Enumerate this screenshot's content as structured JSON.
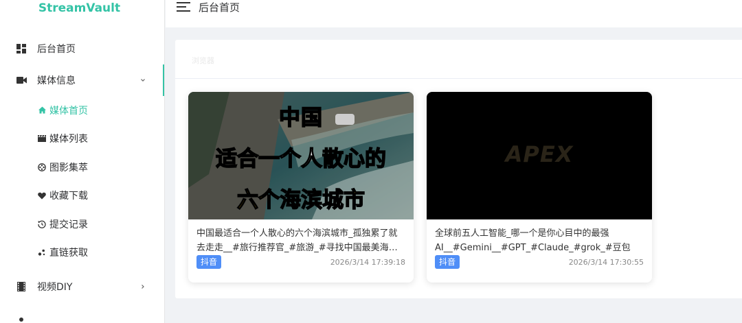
{
  "app": {
    "logo": "StreamVault"
  },
  "header": {
    "title": "后台首页"
  },
  "sidebar": {
    "items": [
      {
        "label": "后台首页",
        "icon": "dashboard-icon"
      },
      {
        "label": "媒体信息",
        "icon": "video-camera-icon",
        "expanded": true,
        "children": [
          {
            "label": "媒体首页",
            "icon": "home-icon",
            "active": true
          },
          {
            "label": "媒体列表",
            "icon": "clapperboard-icon"
          },
          {
            "label": "图影集萃",
            "icon": "film-reel-icon"
          },
          {
            "label": "收藏下载",
            "icon": "heart-icon"
          },
          {
            "label": "提交记录",
            "icon": "history-icon"
          },
          {
            "label": "直链获取",
            "icon": "link-icon"
          }
        ]
      },
      {
        "label": "视频DIY",
        "icon": "film-icon",
        "expanded": false
      }
    ]
  },
  "panel": {
    "heading": "浏览器"
  },
  "cards": [
    {
      "thumb_text": [
        "中国",
        "适合一个人散心的",
        "六个海滨城市"
      ],
      "description": "中国最适合一个人散心的六个海滨城市_孤独累了就去走走__#旅行推荐官_#旅游_#寻找中国最美海滨城市",
      "tag": "抖音",
      "time": "2026/3/14 17:39:18"
    },
    {
      "thumb_text": [
        "APEX"
      ],
      "description": "全球前五人工智能_哪一个是你心目中的最强AI__#Gemini__#GPT_#Claude_#grok_#豆包",
      "tag": "抖音",
      "time": "2026/3/14 17:30:55"
    }
  ],
  "colors": {
    "accent": "#34c3a6",
    "tag": "#4f8ef7",
    "thumb_yellow": "#f5c518"
  }
}
